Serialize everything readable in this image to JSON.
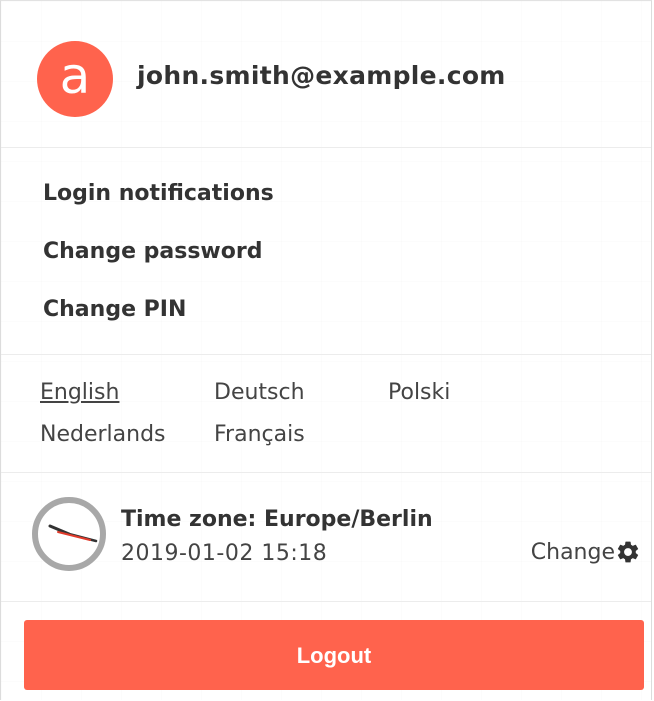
{
  "user": {
    "avatar_letter": "a",
    "email": "john.smith@example.com"
  },
  "menu": {
    "items": [
      {
        "label": "Login notifications"
      },
      {
        "label": "Change password"
      },
      {
        "label": "Change PIN"
      }
    ]
  },
  "languages": {
    "selected": "English",
    "items": [
      {
        "label": "English"
      },
      {
        "label": "Deutsch"
      },
      {
        "label": "Polski"
      },
      {
        "label": "Nederlands"
      },
      {
        "label": "Français"
      }
    ]
  },
  "timezone": {
    "label": "Time zone: Europe/Berlin",
    "datetime": "2019-01-02 15:18",
    "change_label": "Change"
  },
  "logout": {
    "label": "Logout"
  },
  "colors": {
    "accent": "#ff634d",
    "text": "#333333",
    "divider": "#ececec"
  },
  "icons": {
    "clock": "clock-icon",
    "gear": "gear-icon"
  }
}
